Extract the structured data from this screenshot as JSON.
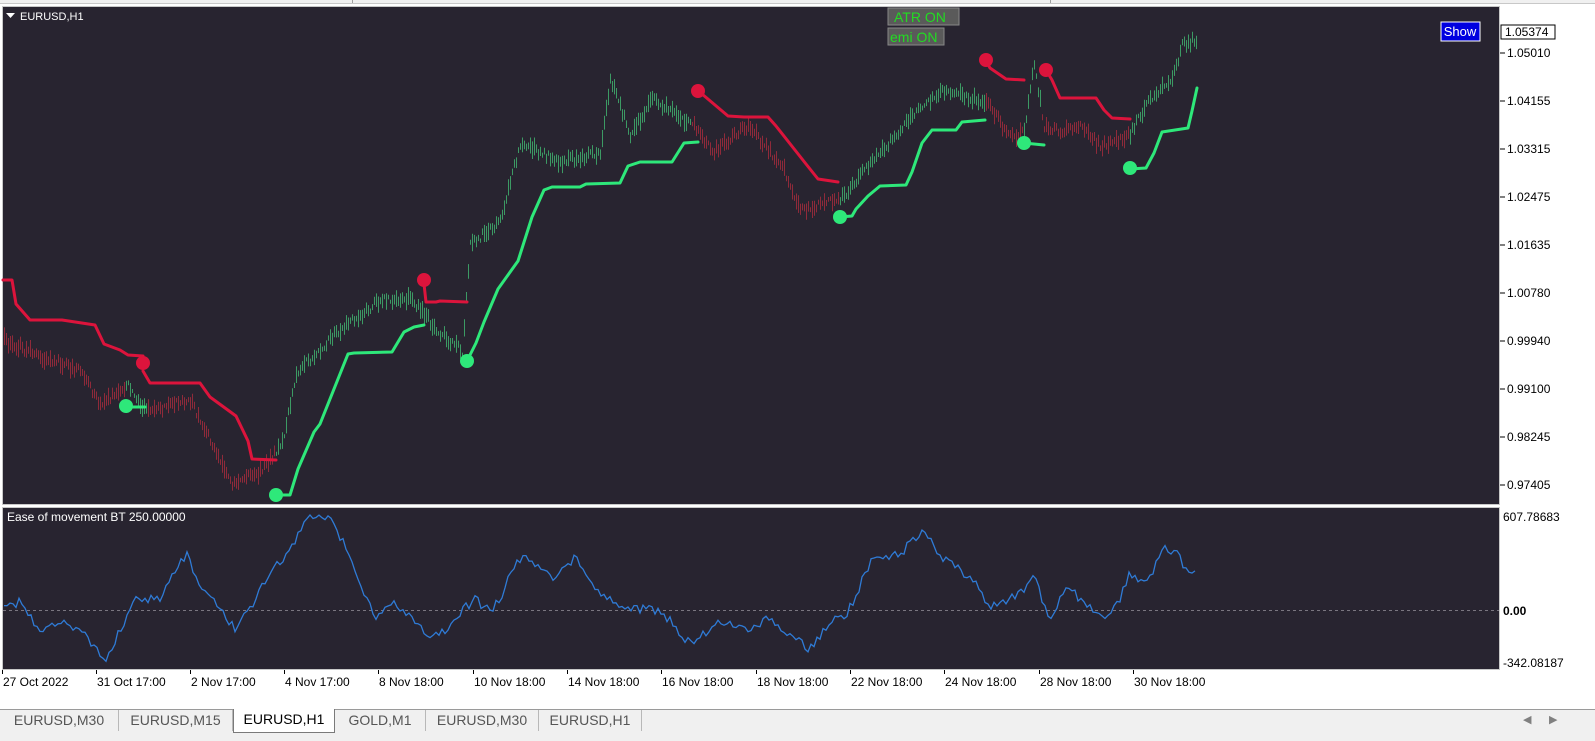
{
  "window": {
    "symbol_title": "EURUSD,H1",
    "show_button": "Show"
  },
  "status_labels": [
    "ATR ON",
    "emi ON"
  ],
  "main_panel": {
    "current_price": "1.05374",
    "price_axis_labels": [
      "1.05010",
      "1.04155",
      "1.03315",
      "1.02475",
      "1.01635",
      "1.00780",
      "0.99940",
      "0.99100",
      "0.98245",
      "0.97405"
    ]
  },
  "indicator_panel": {
    "title": "Ease of movement BT 250.00000",
    "axis_labels": [
      "607.78683",
      "0.00",
      "-342.08187"
    ],
    "line_color": "#2f7bd6"
  },
  "time_axis_labels": [
    "27 Oct 2022",
    "31 Oct 17:00",
    "2 Nov 17:00",
    "4 Nov 17:00",
    "8 Nov 18:00",
    "10 Nov 18:00",
    "14 Nov 18:00",
    "16 Nov 18:00",
    "18 Nov 18:00",
    "22 Nov 18:00",
    "24 Nov 18:00",
    "28 Nov 18:00",
    "30 Nov 18:00"
  ],
  "colors": {
    "background": "#282430",
    "bull": "#2ee87a",
    "bear": "#dc143c",
    "bull_candle": "#3c9a64",
    "bear_candle": "#8f2a3a",
    "border": "#c8c8c8",
    "label_bg": "#5a5a5a",
    "label_text": "#22dd22",
    "button_bg": "#0000e0"
  },
  "tabs": [
    {
      "label": "EURUSD,M30",
      "active": false
    },
    {
      "label": "EURUSD,M15",
      "active": false
    },
    {
      "label": "EURUSD,H1",
      "active": true
    },
    {
      "label": "GOLD,M1",
      "active": false
    },
    {
      "label": "EURUSD,M30",
      "active": false
    },
    {
      "label": "EURUSD,H1",
      "active": false
    }
  ],
  "scroll_arrows": [
    "◀",
    "▶"
  ]
}
